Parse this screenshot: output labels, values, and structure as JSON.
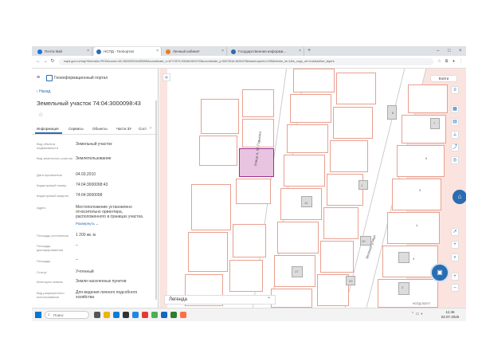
{
  "browser": {
    "tabs": [
      {
        "label": "Почта Mail",
        "color": "#1a73e8"
      },
      {
        "label": "НСПД - Геопортал",
        "color": "#2a6db0"
      },
      {
        "label": "Личный кабинет",
        "color": "#e67e22"
      },
      {
        "label": "Государственная информа...",
        "color": "#2a6db0"
      }
    ],
    "url": "nspd.gov.ru/map?thematic=PKK&zoom=18.262025294455395&coordinate_x=6717873.530461500703&coordinate_y=5872516.4830478&baseLayerId=235&theme_id=1&is_copy_url=true&active_layers"
  },
  "app": {
    "title": "Геоинформационный портал",
    "back_label": "Назад",
    "object_title": "Земельный участок 74:04:3000098:43",
    "tabs": [
      "Информация",
      "Сервисы",
      "Объекты",
      "Части ЗУ",
      "Сост"
    ],
    "fields": [
      {
        "label": "Вид объекта недвижимости",
        "value": "Земельный участок"
      },
      {
        "label": "Вид земельного участка",
        "value": "Землепользование"
      },
      {
        "label": "Дата присвоения",
        "value": "04.03.2010"
      },
      {
        "label": "Кадастровый номер",
        "value": "74:04:3000098:43"
      },
      {
        "label": "Кадастровый квартал",
        "value": "74:04:3000098"
      },
      {
        "label": "Адрес",
        "value": "Местоположение установлено относительно ориентира, расположенного в границах участка.",
        "more": "Развернуть"
      },
      {
        "label": "Площадь уточненная",
        "value": "1 200 кв. м"
      },
      {
        "label": "Площадь декларированная",
        "value": "–"
      },
      {
        "label": "Площадь",
        "value": "–"
      },
      {
        "label": "Статус",
        "value": "Учтенный"
      },
      {
        "label": "Категория земель",
        "value": "Земли населенных пунктов"
      },
      {
        "label": "Вид разрешенного использования",
        "value": "Для ведения личного подсобного хозяйства"
      }
    ]
  },
  "map": {
    "streets": [
      "Улица А. М. Горького",
      "Зеленая улица"
    ],
    "legend_label": "Легенда",
    "search_label": "Войти",
    "plot_numbers": [
      "8",
      "7",
      "6",
      "5",
      "4",
      "3",
      "2",
      "1",
      "12",
      "10",
      "17",
      "20"
    ],
    "copyright": "НСПД 2023 ©"
  },
  "taskbar": {
    "search_placeholder": "Поиск",
    "time": "11:46",
    "date": "02.07.2025"
  }
}
